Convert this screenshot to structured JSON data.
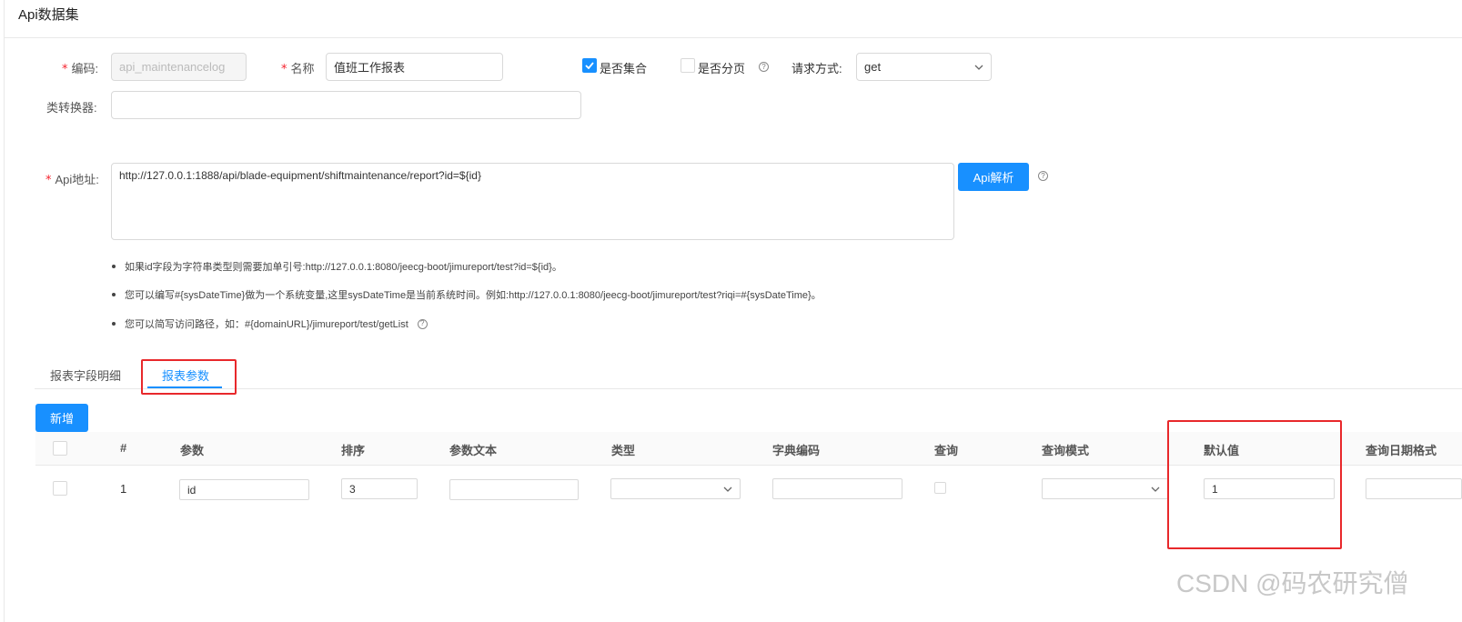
{
  "page_title": "Api数据集",
  "form": {
    "code_label": "编码:",
    "code_value": "api_maintenancelog",
    "name_label": "名称",
    "name_value": "值班工作报表",
    "is_collection_label": "是否集合",
    "is_collection_checked": true,
    "is_paged_label": "是否分页",
    "is_paged_checked": false,
    "request_method_label": "请求方式:",
    "request_method_value": "get",
    "converter_label": "类转换器:",
    "converter_value": "",
    "api_url_label": "Api地址:",
    "api_url_value": "http://127.0.0.1:1888/api/blade-equipment/shiftmaintenance/report?id=${id}",
    "api_parse_button": "Api解析"
  },
  "hints": [
    "如果id字段为字符串类型则需要加单引号:http://127.0.0.1:8080/jeecg-boot/jimureport/test?id=${id}。",
    "您可以编写#{sysDateTime}做为一个系统变量,这里sysDateTime是当前系统时间。例如:http://127.0.0.1:8080/jeecg-boot/jimureport/test?riqi=#{sysDateTime}。",
    "您可以简写访问路径，如：#{domainURL}/jimureport/test/getList"
  ],
  "tabs": [
    {
      "label": "报表字段明细",
      "active": false
    },
    {
      "label": "报表参数",
      "active": true
    }
  ],
  "add_button": "新增",
  "table": {
    "headers": [
      "#",
      "参数",
      "排序",
      "参数文本",
      "类型",
      "字典编码",
      "查询",
      "查询模式",
      "默认值",
      "查询日期格式"
    ],
    "rows": [
      {
        "index": "1",
        "param": "id",
        "order": "3",
        "param_text": "",
        "type": "",
        "dict_code": "",
        "query_checked": false,
        "query_mode": "",
        "default_value": "1",
        "date_format": ""
      }
    ]
  },
  "watermark": "CSDN @码农研究僧",
  "colors": {
    "primary": "#1890ff",
    "required": "#f5222d",
    "highlight": "#e8282b"
  },
  "icons": [
    "check-icon",
    "help-icon",
    "chevron-down-icon"
  ]
}
